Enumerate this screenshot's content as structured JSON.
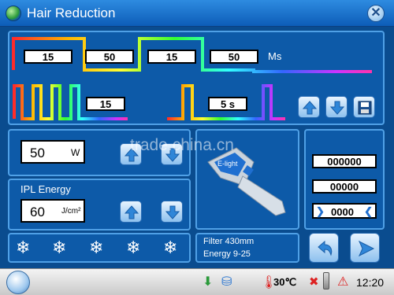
{
  "window": {
    "title": "Hair Reduction"
  },
  "pulse_top": {
    "values": [
      "15",
      "50",
      "15",
      "50"
    ],
    "unit": "Ms"
  },
  "pulse_bottom": {
    "count": "15",
    "interval": "5 s"
  },
  "power": {
    "value": "50",
    "unit": "W"
  },
  "ipl": {
    "label": "IPL Energy",
    "value": "60",
    "unit": "J/cm²"
  },
  "counters": {
    "c1": "000000",
    "c2": "00000",
    "c3": "0000"
  },
  "info": {
    "filter": "Filter  430mm",
    "energy": "Energy  9-25"
  },
  "handpiece": {
    "brand": "E-light"
  },
  "taskbar": {
    "temp": "30℃",
    "time": "12:20"
  },
  "watermark": "trade.china.cn",
  "colors": {
    "accent": "#4fa0e6",
    "background": "#0a4c8f"
  }
}
